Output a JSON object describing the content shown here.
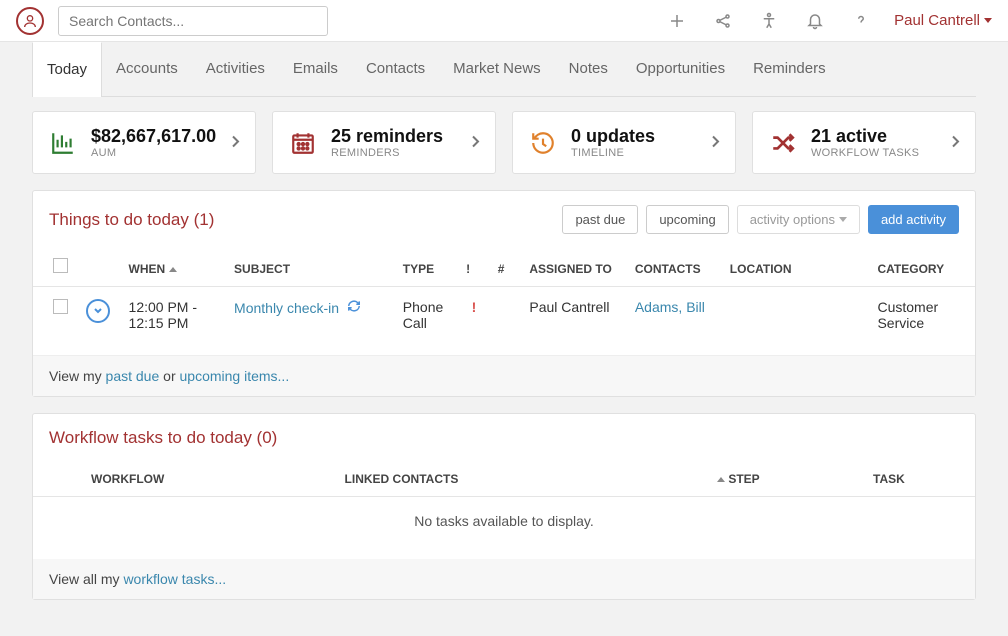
{
  "header": {
    "search_placeholder": "Search Contacts...",
    "user_name": "Paul Cantrell"
  },
  "nav": {
    "tabs": [
      "Today",
      "Accounts",
      "Activities",
      "Emails",
      "Contacts",
      "Market News",
      "Notes",
      "Opportunities",
      "Reminders"
    ],
    "active": 0
  },
  "summary": {
    "aum": {
      "value": "$82,667,617.00",
      "label": "AUM"
    },
    "reminders": {
      "value": "25 reminders",
      "label": "REMINDERS"
    },
    "updates": {
      "value": "0 updates",
      "label": "TIMELINE"
    },
    "workflow": {
      "value": "21 active",
      "label": "WORKFLOW TASKS"
    }
  },
  "todo": {
    "title": "Things to do today (1)",
    "btn_past_due": "past due",
    "btn_upcoming": "upcoming",
    "btn_options": "activity options",
    "btn_add": "add activity",
    "columns": {
      "when": "WHEN",
      "subject": "SUBJECT",
      "type": "TYPE",
      "bang": "!",
      "hash": "#",
      "assigned": "ASSIGNED TO",
      "contacts": "CONTACTS",
      "location": "LOCATION",
      "category": "CATEGORY"
    },
    "rows": [
      {
        "when": "12:00 PM - 12:15 PM",
        "subject": "Monthly check-in",
        "type": "Phone Call",
        "bang": "!",
        "hash": "",
        "assigned": "Paul Cantrell",
        "contacts": "Adams, Bill",
        "location": "",
        "category": "Customer Service"
      }
    ],
    "footer_prefix": "View my ",
    "footer_link1": "past due",
    "footer_or": " or ",
    "footer_link2": "upcoming items..."
  },
  "workflow_panel": {
    "title": "Workflow tasks to do today (0)",
    "columns": {
      "workflow": "WORKFLOW",
      "linked": "LINKED CONTACTS",
      "step": "STEP",
      "task": "TASK"
    },
    "empty": "No tasks available to display.",
    "footer_prefix": "View all my ",
    "footer_link": "workflow tasks..."
  }
}
